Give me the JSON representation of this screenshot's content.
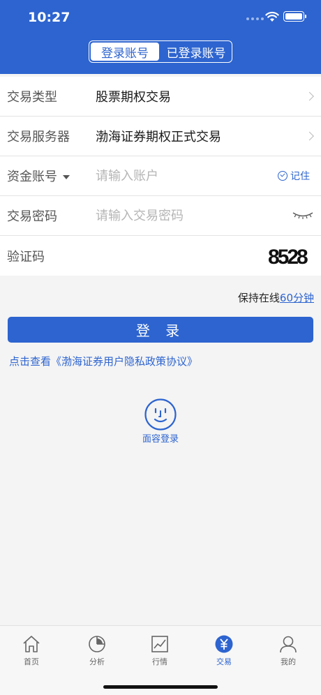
{
  "status": {
    "time": "10:27"
  },
  "segment": {
    "tabs": [
      {
        "label": "登录账号"
      },
      {
        "label": "已登录账号"
      }
    ]
  },
  "form": {
    "trade_type": {
      "label": "交易类型",
      "value": "股票期权交易"
    },
    "server": {
      "label": "交易服务器",
      "value": "渤海证券期权正式交易"
    },
    "account": {
      "label": "资金账号",
      "placeholder": "请输入账户",
      "remember": "记住"
    },
    "password": {
      "label": "交易密码",
      "placeholder": "请输入交易密码"
    },
    "captcha": {
      "label": "验证码",
      "code": "8528"
    }
  },
  "keep_online": {
    "prefix": "保持在线",
    "link": "60分钟"
  },
  "login_button": "登 录",
  "policy_link": "点击查看《渤海证券用户隐私政策协议》",
  "face_login": "面容登录",
  "tabbar": {
    "items": [
      {
        "label": "首页"
      },
      {
        "label": "分析"
      },
      {
        "label": "行情"
      },
      {
        "label": "交易"
      },
      {
        "label": "我的"
      }
    ]
  },
  "colors": {
    "brand": "#2d64cf"
  }
}
